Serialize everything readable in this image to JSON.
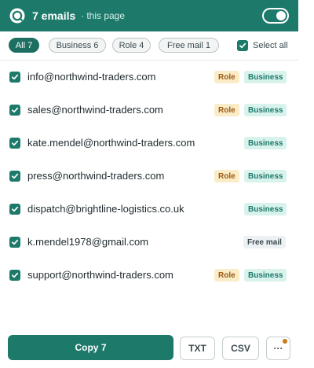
{
  "header": {
    "count_label": "7 emails",
    "scope_label": "· this page",
    "toggle_on": true
  },
  "filters": {
    "chips": [
      {
        "label": "All 7",
        "active": true
      },
      {
        "label": "Business 6",
        "active": false
      },
      {
        "label": "Role 4",
        "active": false
      },
      {
        "label": "Free mail 1",
        "active": false
      }
    ],
    "select_all_label": "Select all",
    "select_all_checked": true
  },
  "emails": [
    {
      "address": "info@northwind-traders.com",
      "checked": true,
      "tags": [
        "Role",
        "Business"
      ]
    },
    {
      "address": "sales@northwind-traders.com",
      "checked": true,
      "tags": [
        "Role",
        "Business"
      ]
    },
    {
      "address": "kate.mendel@northwind-traders.com",
      "checked": true,
      "tags": [
        "Business"
      ]
    },
    {
      "address": "press@northwind-traders.com",
      "checked": true,
      "tags": [
        "Role",
        "Business"
      ]
    },
    {
      "address": "dispatch@brightline-logistics.co.uk",
      "checked": true,
      "tags": [
        "Business"
      ]
    },
    {
      "address": "k.mendel1978@gmail.com",
      "checked": true,
      "tags": [
        "Free mail"
      ]
    },
    {
      "address": "support@northwind-traders.com",
      "checked": true,
      "tags": [
        "Role",
        "Business"
      ]
    }
  ],
  "footer": {
    "copy_label": "Copy 7",
    "txt_label": "TXT",
    "csv_label": "CSV",
    "more_label": "···",
    "more_has_notification": true
  },
  "colors": {
    "brand": "#1d7a6b",
    "role_badge_bg": "#fbecc8",
    "business_badge_bg": "#d8f2ec",
    "free_badge_bg": "#eef1f4",
    "notification_dot": "#c97a16"
  }
}
